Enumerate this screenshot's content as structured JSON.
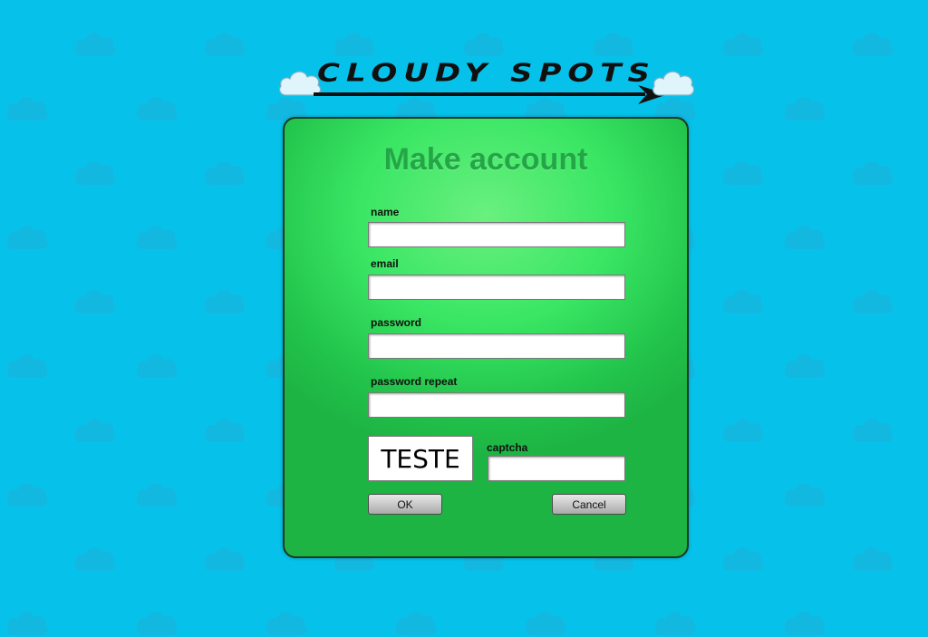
{
  "logo": {
    "text": "CLOUDY SPOTS"
  },
  "form": {
    "title": "Make account",
    "fields": {
      "name": {
        "label": "name",
        "value": ""
      },
      "email": {
        "label": "email",
        "value": ""
      },
      "password": {
        "label": "password",
        "value": ""
      },
      "password_repeat": {
        "label": "password repeat",
        "value": ""
      },
      "captcha": {
        "label": "captcha",
        "value": ""
      }
    },
    "captcha_image_text": "TESTE",
    "ok_label": "OK",
    "cancel_label": "Cancel"
  },
  "colors": {
    "background": "#06c2ea",
    "card_green": "#3ae664",
    "title_green": "#24a647"
  },
  "icons": [
    "cloud-icon",
    "arrow-icon"
  ]
}
